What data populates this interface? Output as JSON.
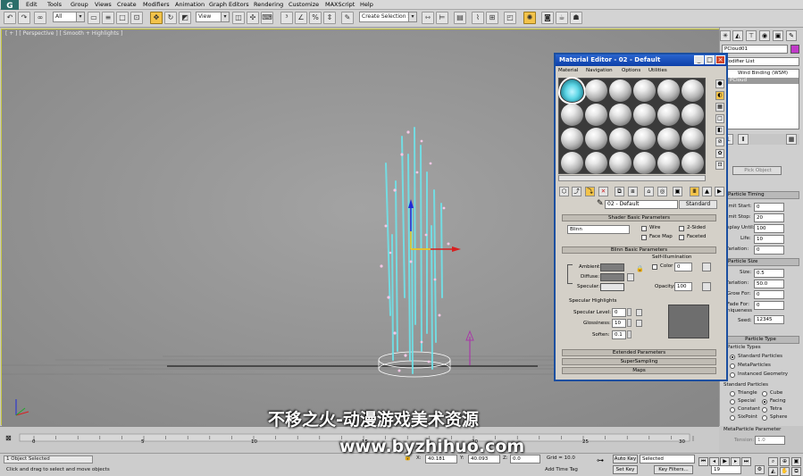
{
  "menubar": {
    "items": [
      "Edit",
      "Tools",
      "Group",
      "Views",
      "Create",
      "Modifiers",
      "Animation",
      "Graph Editors",
      "Rendering",
      "Customize",
      "MAXScript",
      "Help"
    ]
  },
  "toolbar": {
    "filter_value": "All",
    "refcoord_value": "View",
    "selection_set_placeholder": "Create Selection Se"
  },
  "viewport": {
    "label": "[ + ] [ Perspective ] [ Smooth + Highlights ]"
  },
  "material_editor": {
    "title": "Material Editor - 02 - Default",
    "menu": [
      "Material",
      "Navigation",
      "Options",
      "Utilities"
    ],
    "material_name": "02 - Default",
    "material_type": "Standard",
    "shader_rollout": "Shader Basic Parameters",
    "shader_value": "Blinn",
    "wire": "Wire",
    "two_sided": "2-Sided",
    "face_map": "Face Map",
    "faceted": "Faceted",
    "blinn_rollout": "Blinn Basic Parameters",
    "self_illum": "Self-Illumination",
    "color": "Color",
    "color_value": "0",
    "ambient": "Ambient:",
    "diffuse": "Diffuse:",
    "specular": "Specular:",
    "opacity": "Opacity:",
    "opacity_value": "100",
    "spec_highlights": "Specular Highlights",
    "spec_level": "Specular Level:",
    "spec_level_value": "0",
    "glossiness": "Glossiness:",
    "glossiness_value": "10",
    "soften": "Soften:",
    "soften_value": "0.1",
    "extended": "Extended Parameters",
    "supersampling": "SuperSampling",
    "maps": "Maps"
  },
  "command_panel": {
    "object_name": "PCloud01",
    "modifier_list": "Modifier List",
    "stack": [
      "Wind Binding (WSM)",
      "PCloud"
    ],
    "pick_object": "Pick Object",
    "particle_timing": "Particle Timing",
    "emit_start": "Emit Start:",
    "emit_start_value": "0",
    "emit_stop": "Emit Stop:",
    "emit_stop_value": "20",
    "display_until": "Display Until:",
    "display_until_value": "100",
    "life": "Life:",
    "life_value": "10",
    "variation": "Variation:",
    "variation_value": "0",
    "particle_size": "Particle Size",
    "size": "Size:",
    "size_value": "0.5",
    "size_variation": "Variation:",
    "size_variation_value": "50.0",
    "grow_for": "Grow For:",
    "grow_for_value": "0",
    "fade_for": "Fade For:",
    "fade_for_value": "0",
    "uniqueness": "Uniqueness",
    "seed": "Seed:",
    "seed_value": "12345",
    "particle_type": "Particle Type",
    "particle_types": "Particle Types",
    "standard_particles": "Standard Particles",
    "metaparticles": "MetaParticles",
    "instanced_geometry": "Instanced Geometry",
    "standard_particles_group": "Standard Particles",
    "triangle": "Triangle",
    "cube": "Cube",
    "special": "Special",
    "facing": "Facing",
    "constant": "Constant",
    "tetra": "Tetra",
    "sixpoint": "SixPoint",
    "sphere": "Sphere",
    "metaparticle_params": "MetaParticle Parameter",
    "tension": "Tension:",
    "tension_value": "1.0"
  },
  "timeline": {
    "ticks": [
      "0",
      "5",
      "10",
      "15",
      "20",
      "25",
      "30"
    ]
  },
  "status": {
    "selected": "1 Object Selected",
    "prompt": "Click and drag to select and move objects",
    "x_value": "40.181",
    "y_value": "40.093",
    "z_value": "0.0",
    "grid": "Grid = 10.0",
    "add_time_tag": "Add Time Tag",
    "auto_key": "Auto Key",
    "auto_key_mode": "Selected",
    "set_key": "Set Key",
    "key_filters": "Key Filters...",
    "frame": "19"
  },
  "watermark": {
    "line1": "不移之火-动漫游戏美术资源",
    "line2": "www.byzhihuo.com"
  },
  "colors": {
    "title_bar": "#1b4fa0",
    "viewport_bg": "#9a9a9a",
    "active_tool": "#f3c34a",
    "particles": "#6fe3ea"
  }
}
